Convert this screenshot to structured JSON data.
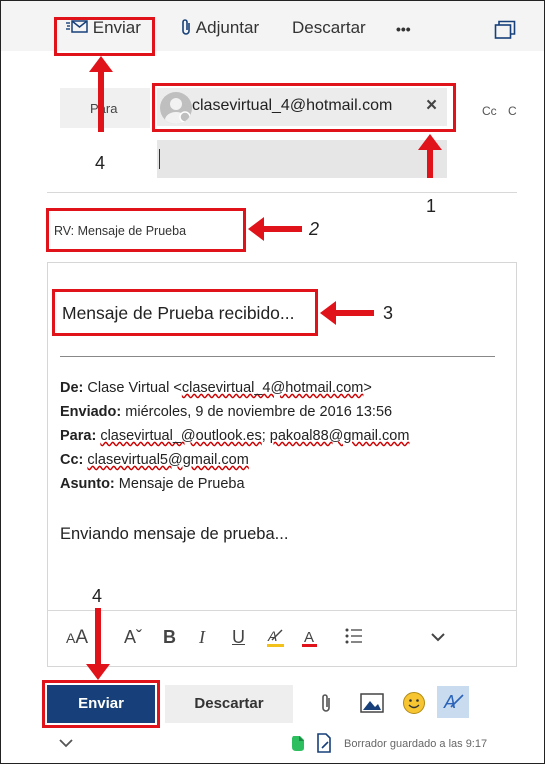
{
  "toolbar": {
    "send_label": "Enviar",
    "attach_label": "Adjuntar",
    "discard_label": "Descartar",
    "more_label": "•••"
  },
  "recipients": {
    "to_label": "Para",
    "to_chip": "clasevirtual_4@hotmail.com",
    "remove_glyph": "×",
    "cc_label": "Cc",
    "bcc_label": "C"
  },
  "subject": "RV: Mensaje de Prueba",
  "body": {
    "intro": "Mensaje de Prueba recibido...",
    "from_label": "De:",
    "from_name": "Clase Virtual <",
    "from_email": "clasevirtual_4@hotmail.com",
    "from_close": ">",
    "sent_label": "Enviado:",
    "sent_value": "miércoles, 9 de noviembre de 2016 13:56",
    "to_label": "Para:",
    "to_value_1": "clasevirtual_@outlook.es",
    "to_sep": "; ",
    "to_value_2": "pakoal88@gmail.com",
    "cc_label": "Cc:",
    "cc_value": "clasevirtual5@gmail.com",
    "subject_label": "Asunto:",
    "subject_value": "Mensaje de Prueba",
    "forward_text": "Enviando mensaje de prueba..."
  },
  "footer": {
    "send_label": "Enviar",
    "discard_label": "Descartar",
    "status": "Borrador guardado a las 9:17"
  },
  "annotations": {
    "n1": "1",
    "n2": "2",
    "n3": "3",
    "n4_top": "4",
    "n4_bottom": "4"
  },
  "colors": {
    "highlight": "#e0131a",
    "send_button": "#17407a",
    "toolbar_bg": "#f4f4f4"
  }
}
